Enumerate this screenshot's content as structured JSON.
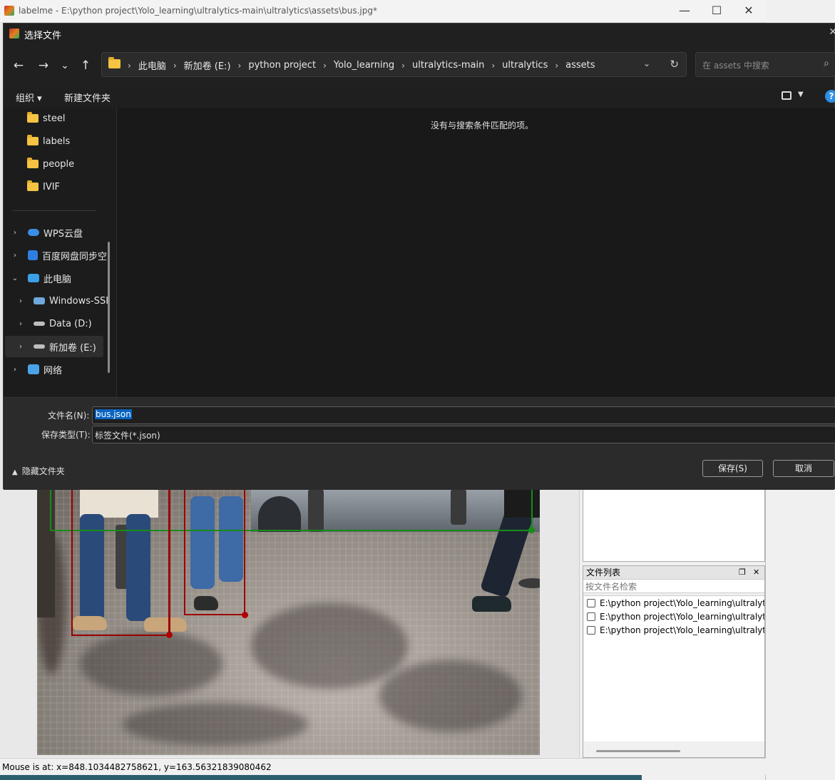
{
  "window": {
    "title": "labelme - E:\\python project\\Yolo_learning\\ultralytics-main\\ultralytics\\assets\\bus.jpg*",
    "minimize_glyph": "—",
    "maximize_glyph": "☐",
    "close_glyph": "✕"
  },
  "dialog": {
    "title": "选择文件",
    "close_glyph": "✕",
    "nav": {
      "back": "←",
      "forward": "→",
      "recent": "⌄",
      "up": "↑"
    },
    "breadcrumb": [
      "此电脑",
      "新加卷 (E:)",
      "python project",
      "Yolo_learning",
      "ultralytics-main",
      "ultralytics",
      "assets"
    ],
    "breadcrumb_separator": "›",
    "search_placeholder": "在 assets 中搜索",
    "toolbar": {
      "organize": "组织 ▾",
      "new_folder": "新建文件夹",
      "help": "?"
    },
    "sidebar": {
      "quick": [
        {
          "label": "steel"
        },
        {
          "label": "labels"
        },
        {
          "label": "people"
        },
        {
          "label": "IVIF"
        }
      ],
      "tree": [
        {
          "label": "WPS云盘",
          "chevron": "›",
          "icon": "cloud-icon",
          "icon_color": "#3a8ee6",
          "level": 0
        },
        {
          "label": "百度网盘同步空",
          "chevron": "›",
          "icon": "baidu-netdisk-icon",
          "icon_color": "#2f7fe0",
          "level": 0
        },
        {
          "label": "此电脑",
          "chevron": "⌄",
          "icon": "computer-icon",
          "icon_color": "#3aa0e8",
          "level": 0
        },
        {
          "label": "Windows-SSI",
          "chevron": "›",
          "icon": "windows-drive-icon",
          "icon_color": "#6fa8dc",
          "level": 1
        },
        {
          "label": "Data (D:)",
          "chevron": "›",
          "icon": "drive-icon",
          "icon_color": "#bdbdbd",
          "level": 1
        },
        {
          "label": "新加卷 (E:)",
          "chevron": "›",
          "icon": "drive-icon",
          "icon_color": "#bdbdbd",
          "level": 1,
          "selected": true
        },
        {
          "label": "网络",
          "chevron": "›",
          "icon": "network-icon",
          "icon_color": "#4aa3e8",
          "level": 0
        }
      ]
    },
    "empty_message": "没有与搜索条件匹配的项。",
    "filename_label": "文件名(N):",
    "filename_value": "bus.json",
    "filetype_label": "保存类型(T):",
    "filetype_value": "标签文件(*.json)",
    "hide_folders": "隐藏文件夹",
    "save_button": "保存(S)",
    "cancel_button": "取消"
  },
  "file_dock": {
    "title": "文件列表",
    "float_glyph": "❐",
    "close_glyph": "✕",
    "search_placeholder": "按文件名检索",
    "files": [
      "E:\\python project\\Yolo_learning\\ultralytics-main\\ultralytics\\assets\\bus.jpg",
      "E:\\python project\\Yolo_learning\\ultralytics-main\\ultralytics\\assets\\zidane.jpg",
      "E:\\python project\\Yolo_learning\\ultralytics-main\\ultralytics\\assets\\image.jpg"
    ]
  },
  "status": {
    "text": "Mouse is at: x=848.1034482758621, y=163.56321839080462"
  },
  "colors": {
    "dialog_bg": "#202020",
    "selection_blue": "#0a64c2",
    "bbox_red": "#9b0000",
    "bbox_green": "#178c17"
  }
}
